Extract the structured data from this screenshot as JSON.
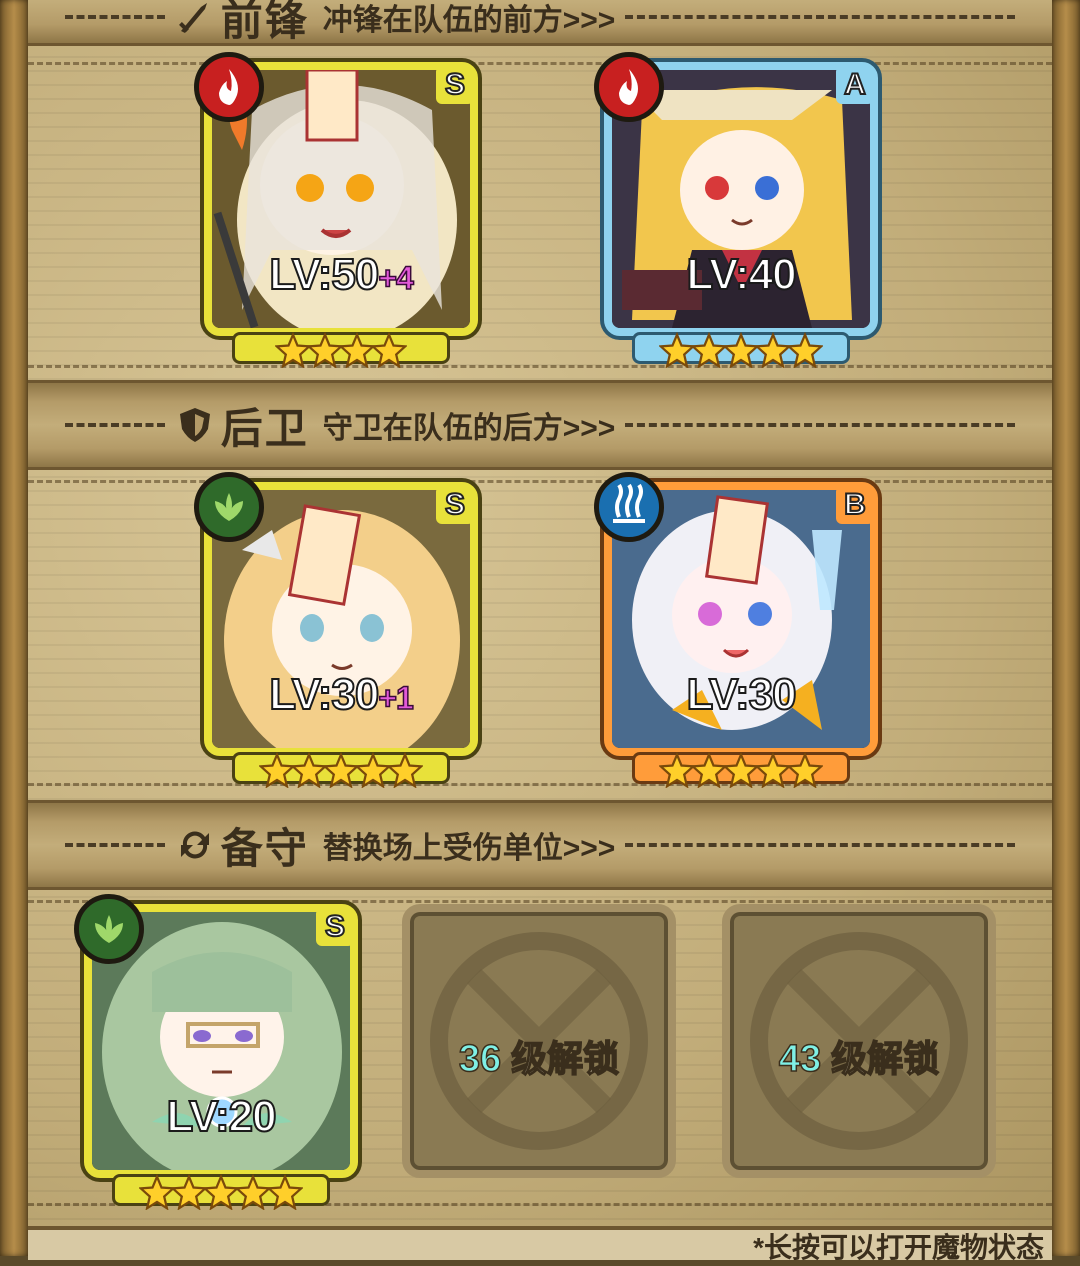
{
  "sections": {
    "front": {
      "title": "前锋",
      "subtitle": "冲锋在队伍的前方>>>"
    },
    "back": {
      "title": "后卫",
      "subtitle": "守卫在队伍的后方>>>"
    },
    "reserve": {
      "title": "备守",
      "subtitle": "替换场上受伤单位>>>"
    }
  },
  "heroes": {
    "front_1": {
      "rank": "S",
      "element": "fire",
      "level": "LV:50",
      "bonus": "+4",
      "stars": 4
    },
    "front_2": {
      "rank": "A",
      "element": "fire",
      "level": "LV:40",
      "bonus": "",
      "stars": 5
    },
    "back_1": {
      "rank": "S",
      "element": "leaf",
      "level": "LV:30",
      "bonus": "+1",
      "stars": 5
    },
    "back_2": {
      "rank": "B",
      "element": "water",
      "level": "LV:30",
      "bonus": "",
      "stars": 5
    },
    "reserve_1": {
      "rank": "S",
      "element": "leaf",
      "level": "LV:20",
      "bonus": "",
      "stars": 5
    }
  },
  "locked_slots": {
    "slot_2": {
      "level": "36",
      "label": "级解锁"
    },
    "slot_3": {
      "level": "43",
      "label": "级解锁"
    }
  },
  "footer": {
    "note": "*长按可以打开魔物状态"
  }
}
